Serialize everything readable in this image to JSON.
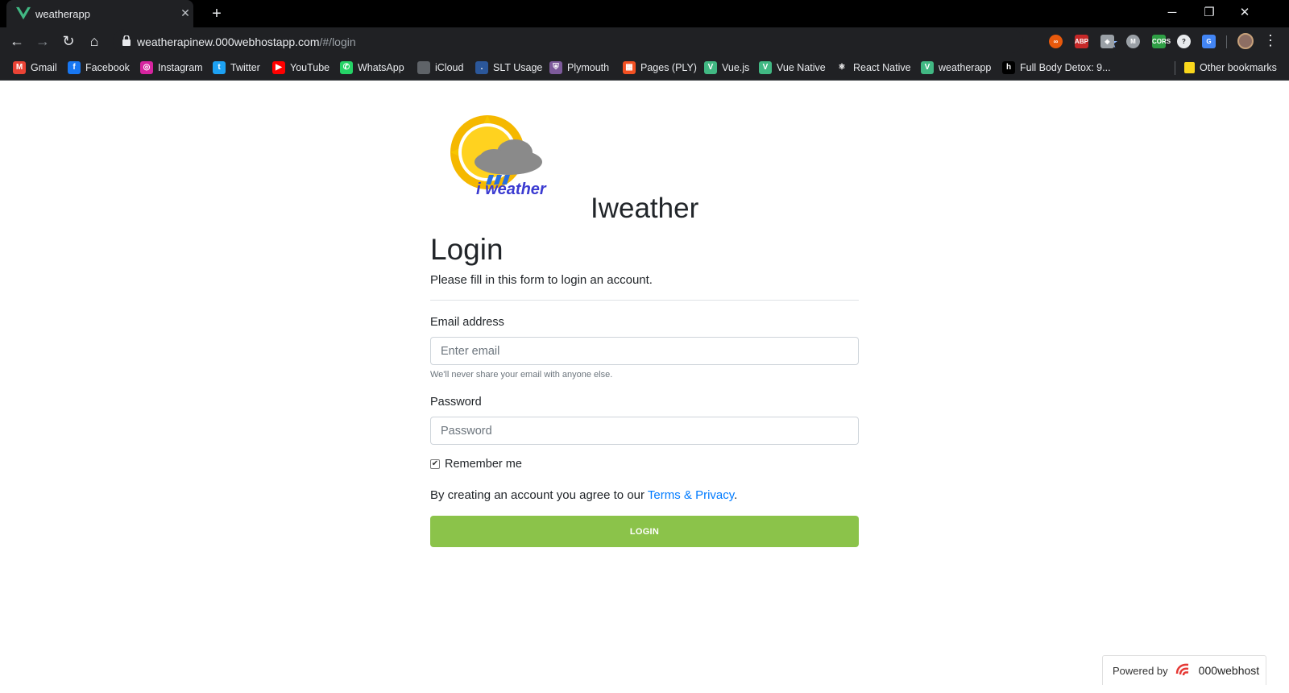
{
  "browser": {
    "tab_title": "weatherapp",
    "url_host": "weatherapinew.000webhostapp.com",
    "url_path": "/#/login",
    "bookmarks": [
      {
        "label": "Gmail",
        "icon": "gmail-icon",
        "color": "#ea4335",
        "glyph": "M"
      },
      {
        "label": "Facebook",
        "icon": "facebook-icon",
        "color": "#1877f2",
        "glyph": "f"
      },
      {
        "label": "Instagram",
        "icon": "instagram-icon",
        "color": "#d6249f",
        "glyph": "◎"
      },
      {
        "label": "Twitter",
        "icon": "twitter-icon",
        "color": "#1da1f2",
        "glyph": "t"
      },
      {
        "label": "YouTube",
        "icon": "youtube-icon",
        "color": "#ff0000",
        "glyph": "▶"
      },
      {
        "label": "WhatsApp",
        "icon": "whatsapp-icon",
        "color": "#25d366",
        "glyph": "✆"
      },
      {
        "label": "iCloud",
        "icon": "apple-icon",
        "color": "#5f6368",
        "glyph": ""
      },
      {
        "label": "SLT Usage",
        "icon": "slt-icon",
        "color": "#2b579a",
        "glyph": "."
      },
      {
        "label": "Plymouth",
        "icon": "plymouth-icon",
        "color": "#7d5a9b",
        "glyph": "⛨"
      },
      {
        "label": "Pages (PLY)",
        "icon": "microsoft-icon",
        "color": "#f25022",
        "glyph": "▦"
      },
      {
        "label": "Vue.js",
        "icon": "vue-icon",
        "color": "#41b883",
        "glyph": "V"
      },
      {
        "label": "Vue Native",
        "icon": "vue-native-icon",
        "color": "#41b883",
        "glyph": "V"
      },
      {
        "label": "React Native",
        "icon": "react-icon",
        "color": "#202124",
        "glyph": "⚛"
      },
      {
        "label": "weatherapp",
        "icon": "vue-icon",
        "color": "#41b883",
        "glyph": "V"
      },
      {
        "label": "Full Body Detox: 9...",
        "icon": "hubpages-icon",
        "color": "#000000",
        "glyph": "h"
      }
    ],
    "other_bookmarks": "Other bookmarks"
  },
  "page": {
    "logo_text": "i weather",
    "brand": "Iweather",
    "title": "Login",
    "subtitle": "Please fill in this form to login an account.",
    "email_label": "Email address",
    "email_placeholder": "Enter email",
    "email_help": "We'll never share your email with anyone else.",
    "password_label": "Password",
    "password_placeholder": "Password",
    "remember_label": "Remember me",
    "remember_checked": true,
    "terms_text": "By creating an account you agree to our ",
    "terms_link": "Terms & Privacy",
    "terms_end": ".",
    "login_button": "LOGIN"
  },
  "footer": {
    "powered_by": "Powered by",
    "host_name": "000webhost"
  },
  "colors": {
    "login_button": "#8bc34a",
    "link": "#007bff",
    "chrome_dark": "#202124"
  }
}
